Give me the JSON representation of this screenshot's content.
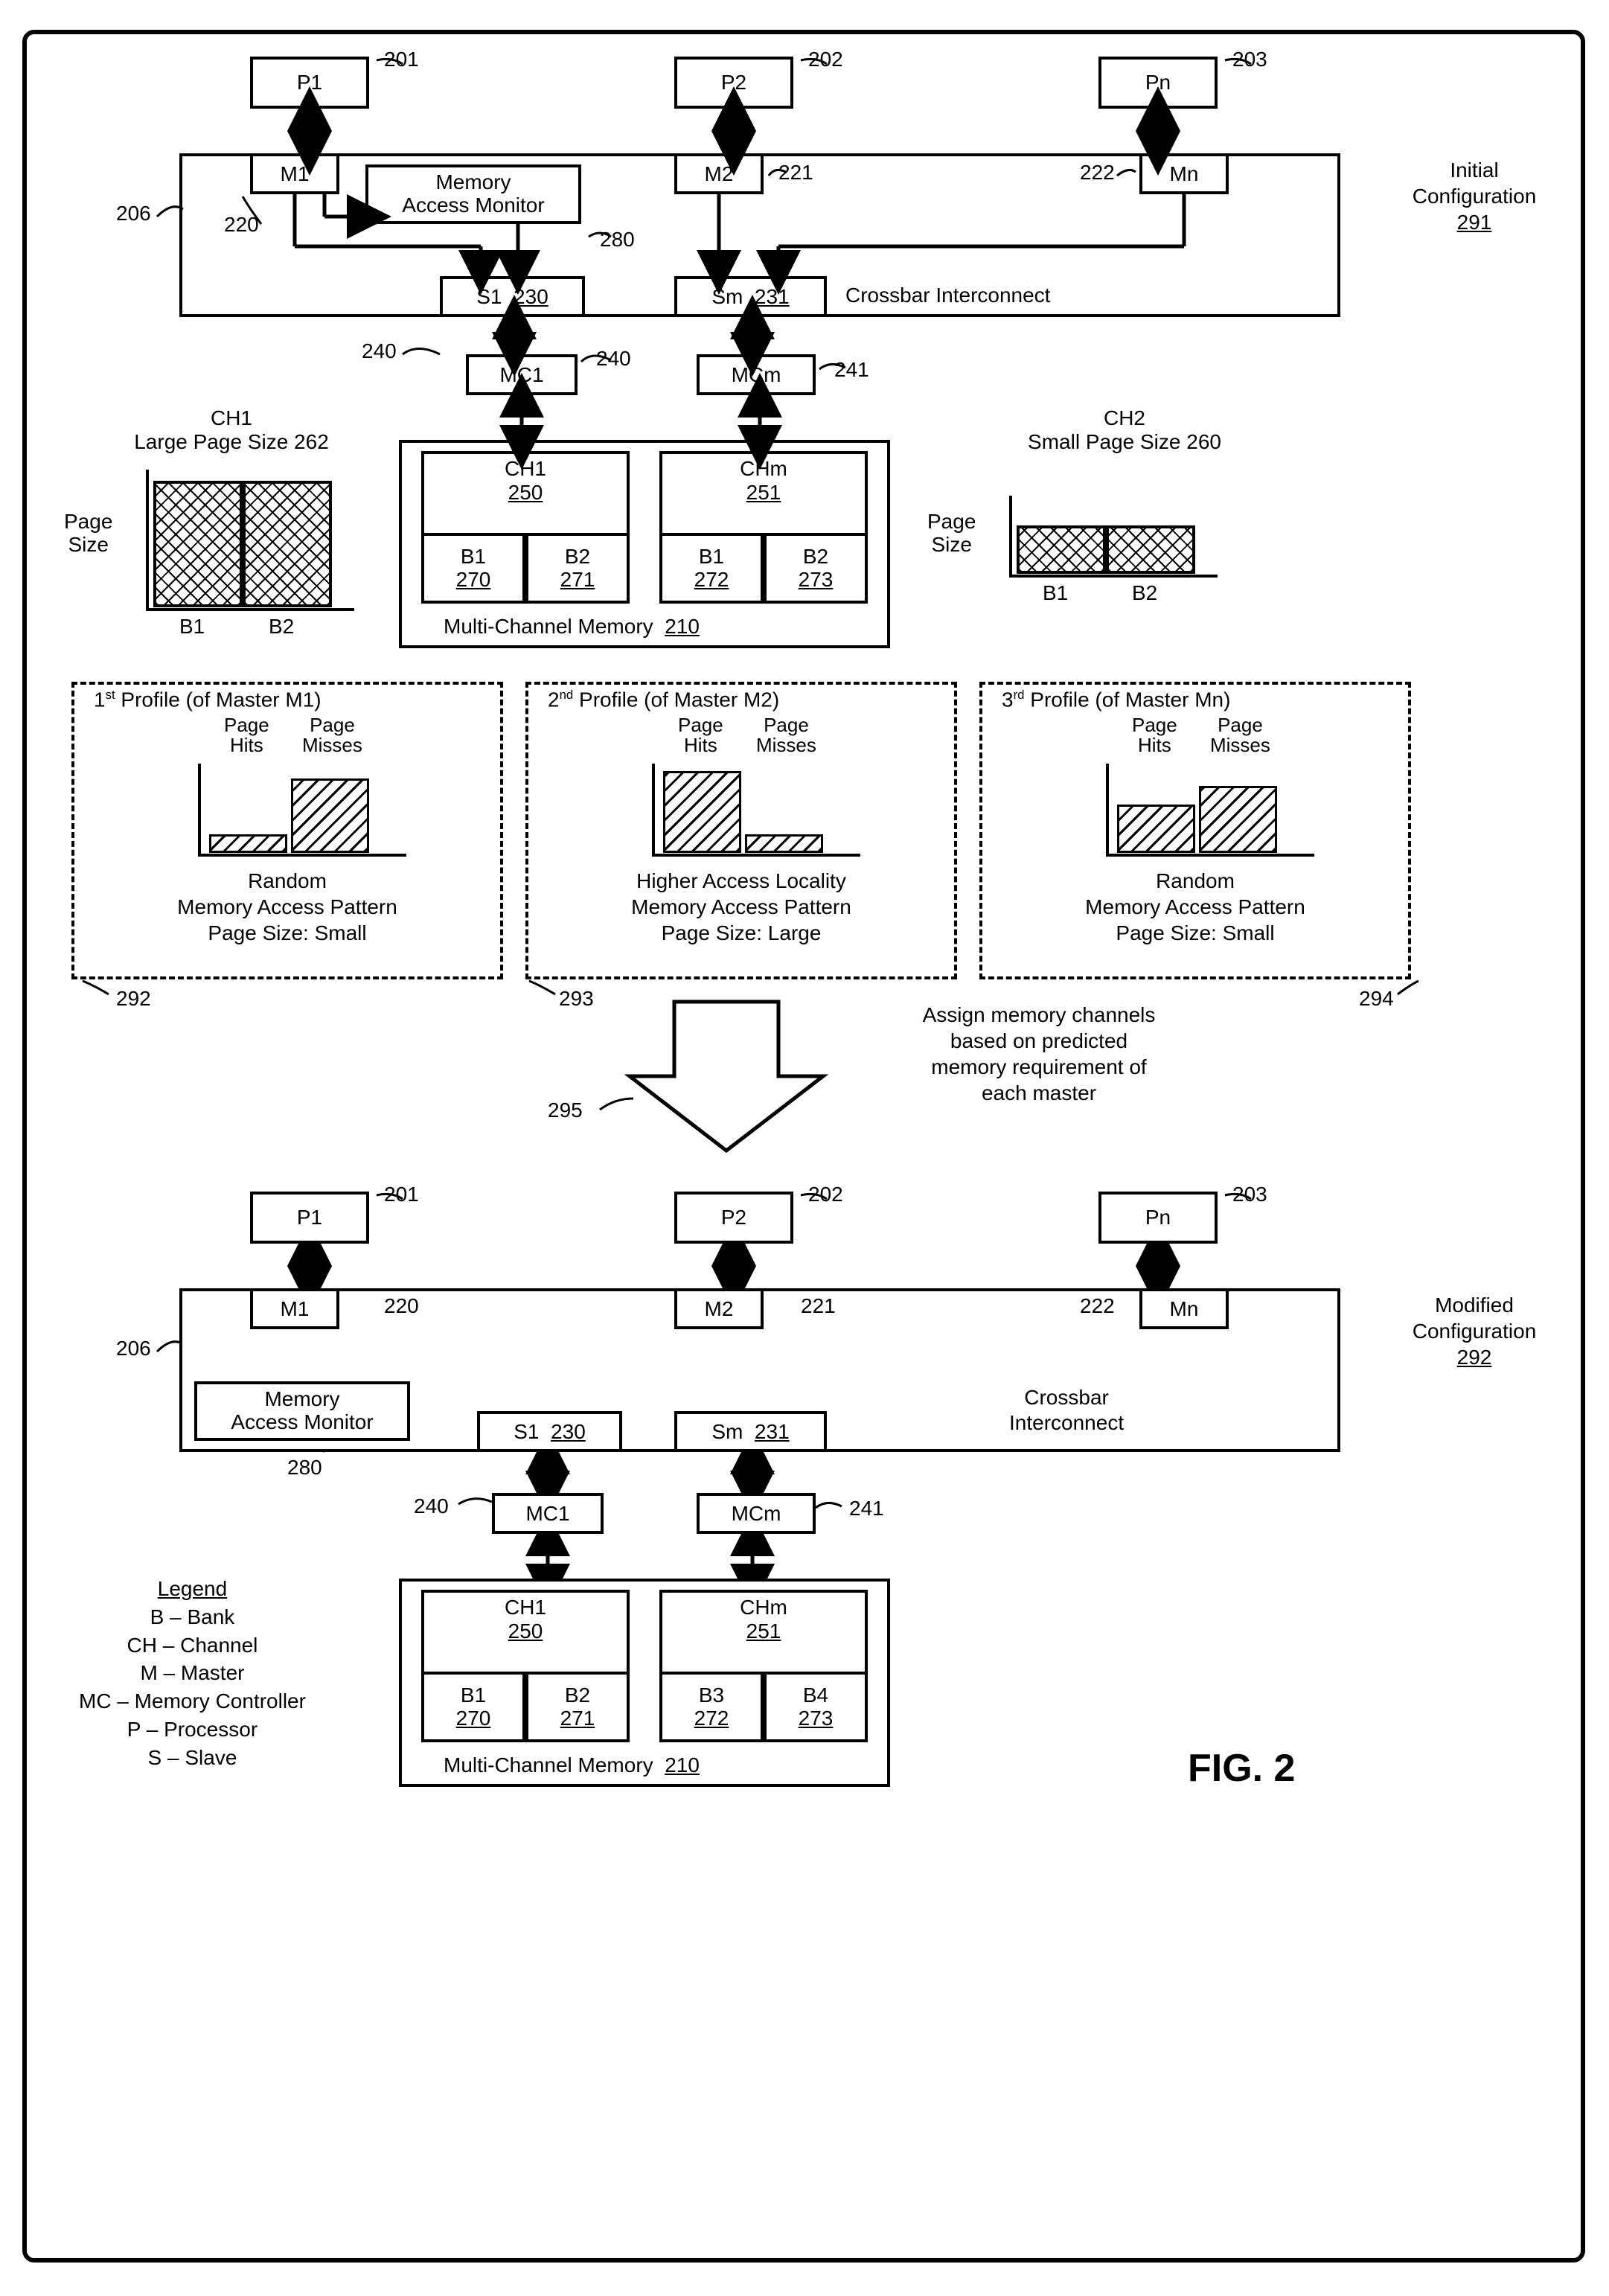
{
  "fig_label": "FIG. 2",
  "processors": {
    "p1": "P1",
    "p2": "P2",
    "pn": "Pn"
  },
  "ref": {
    "p1": "201",
    "p2": "202",
    "pn": "203",
    "crossbar": "206",
    "m1": "220",
    "m2": "221",
    "mn": "222",
    "s1": "230",
    "sm": "231",
    "mc1": "240",
    "mcm": "241",
    "ch1": "250",
    "chm": "251",
    "pagesize_small": "260",
    "pagesize_large": "262",
    "b1a": "270",
    "b2a": "271",
    "b1b": "272",
    "b2b": "273",
    "mam": "280",
    "initial": "291",
    "modified": "292",
    "profile1": "292",
    "profile2": "293",
    "profile3": "294",
    "arrow": "295",
    "memory": "210"
  },
  "masters": {
    "m1": "M1",
    "m2": "M2",
    "mn": "Mn"
  },
  "mam": {
    "line1": "Memory",
    "line2": "Access Monitor"
  },
  "slaves": {
    "s1_label": "S1",
    "s1_ref": "230",
    "sm_label": "Sm",
    "sm_ref": "231"
  },
  "mc": {
    "mc1": "MC1",
    "mcm": "MCm"
  },
  "crossbar_label": "Crossbar Interconnect",
  "crossbar_label_2a": "Crossbar",
  "crossbar_label_2b": "Interconnect",
  "memory_block_label": "Multi-Channel Memory",
  "channels": {
    "ch1": "CH1",
    "chm": "CHm",
    "b1": "B1",
    "b2": "B2",
    "b3": "B3",
    "b4": "B4"
  },
  "initial_cfg": {
    "line1": "Initial",
    "line2": "Configuration"
  },
  "modified_cfg": {
    "line1": "Modified",
    "line2": "Configuration"
  },
  "ch1_side": {
    "line1": "CH1",
    "line2": "Large Page Size 262",
    "axis": "Page",
    "axis2": "Size",
    "b1": "B1",
    "b2": "B2"
  },
  "ch2_side": {
    "line1": "CH2",
    "line2": "Small Page Size 260",
    "axis": "Page",
    "axis2": "Size",
    "b1": "B1",
    "b2": "B2"
  },
  "profiles": {
    "p1": {
      "title_a": "1",
      "title_sup": "st",
      "title_b": " Profile (of Master M1)",
      "head1": "Page",
      "head2": "Page",
      "sub1": "Hits",
      "sub2": "Misses",
      "line1": "Random",
      "line2": "Memory Access Pattern",
      "line3": "Page Size: Small"
    },
    "p2": {
      "title_a": "2",
      "title_sup": "nd",
      "title_b": " Profile (of Master M2)",
      "head1": "Page",
      "head2": "Page",
      "sub1": "Hits",
      "sub2": "Misses",
      "line1": "Higher Access Locality",
      "line2": "Memory Access Pattern",
      "line3": "Page Size: Large"
    },
    "p3": {
      "title_a": "3",
      "title_sup": "rd",
      "title_b": " Profile (of Master Mn)",
      "head1": "Page",
      "head2": "Page",
      "sub1": "Hits",
      "sub2": "Misses",
      "line1": "Random",
      "line2": "Memory Access Pattern",
      "line3": "Page Size: Small"
    }
  },
  "assign_text": {
    "l1": "Assign memory channels",
    "l2": "based on predicted",
    "l3": "memory requirement of",
    "l4": "each master"
  },
  "legend": {
    "title": "Legend",
    "rows": [
      "B – Bank",
      "CH – Channel",
      "M – Master",
      "MC – Memory Controller",
      "P – Processor",
      "S – Slave"
    ]
  },
  "chart_data": [
    {
      "type": "bar",
      "title": "CH1 Large Page Size",
      "categories": [
        "B1",
        "B2"
      ],
      "values": [
        10,
        10
      ],
      "ylabel": "Page Size",
      "ylim": [
        0,
        10
      ]
    },
    {
      "type": "bar",
      "title": "CH2 Small Page Size",
      "categories": [
        "B1",
        "B2"
      ],
      "values": [
        4,
        4
      ],
      "ylabel": "Page Size",
      "ylim": [
        0,
        10
      ]
    },
    {
      "type": "bar",
      "title": "1st Profile (of Master M1)",
      "categories": [
        "Page Hits",
        "Page Misses"
      ],
      "values": [
        2,
        8
      ],
      "annotations": [
        "Random",
        "Memory Access Pattern",
        "Page Size: Small"
      ]
    },
    {
      "type": "bar",
      "title": "2nd Profile (of Master M2)",
      "categories": [
        "Page Hits",
        "Page Misses"
      ],
      "values": [
        8,
        2
      ],
      "annotations": [
        "Higher Access Locality",
        "Memory Access Pattern",
        "Page Size: Large"
      ]
    },
    {
      "type": "bar",
      "title": "3rd Profile (of Master Mn)",
      "categories": [
        "Page Hits",
        "Page Misses"
      ],
      "values": [
        5,
        7
      ],
      "annotations": [
        "Random",
        "Memory Access Pattern",
        "Page Size: Small"
      ]
    }
  ]
}
